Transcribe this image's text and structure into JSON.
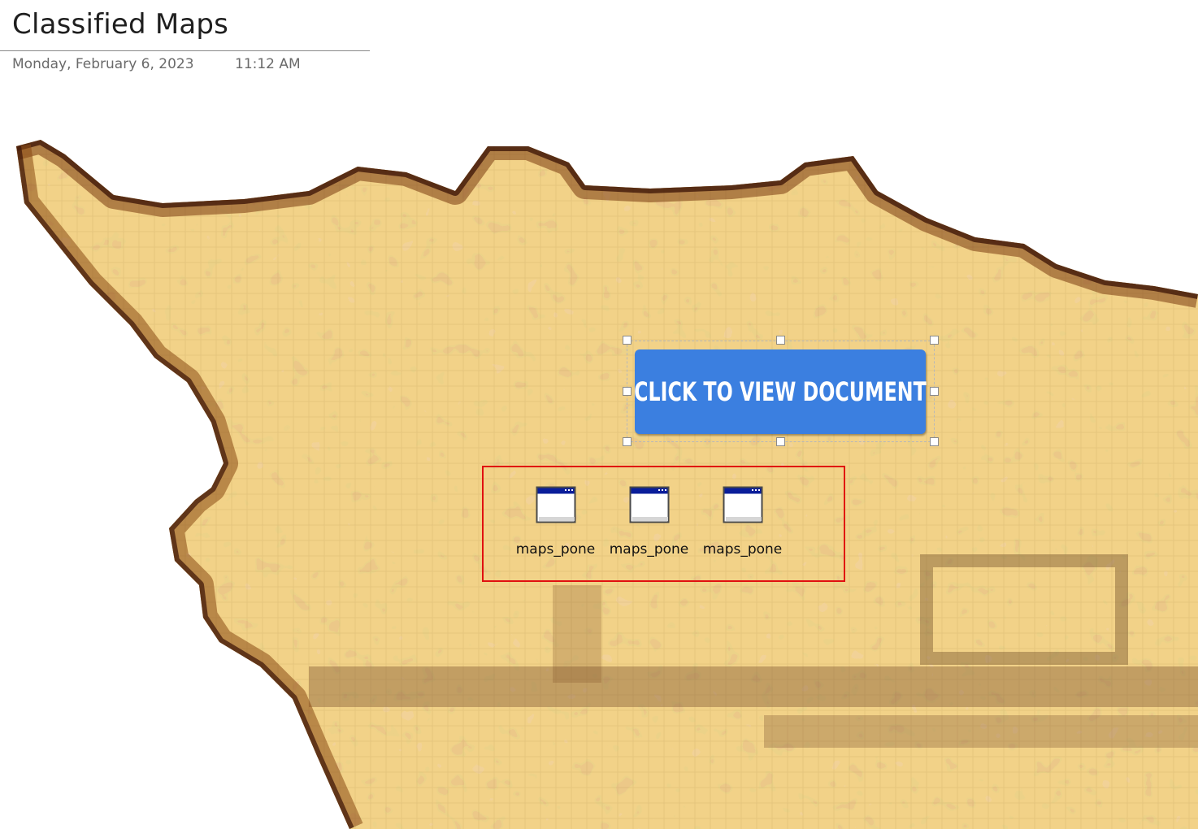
{
  "page": {
    "title": "Classified Maps",
    "date": "Monday, February 6, 2023",
    "time": "11:12 AM"
  },
  "background_image": {
    "icon": "pixelated-old-parchment-map",
    "colors": [
      "#d9ad63",
      "#c4914a",
      "#8a4a1a",
      "#4a1a0a"
    ]
  },
  "cta_button": {
    "label": "CLICK TO VIEW DOCUMENT",
    "color": "#3b7fe0",
    "selected": true
  },
  "attachments": [
    {
      "label": "maps_pone",
      "icon": "window-file-icon"
    },
    {
      "label": "maps_pone",
      "icon": "window-file-icon"
    },
    {
      "label": "maps_pone",
      "icon": "window-file-icon"
    }
  ],
  "highlight": {
    "color": "#e01010"
  }
}
